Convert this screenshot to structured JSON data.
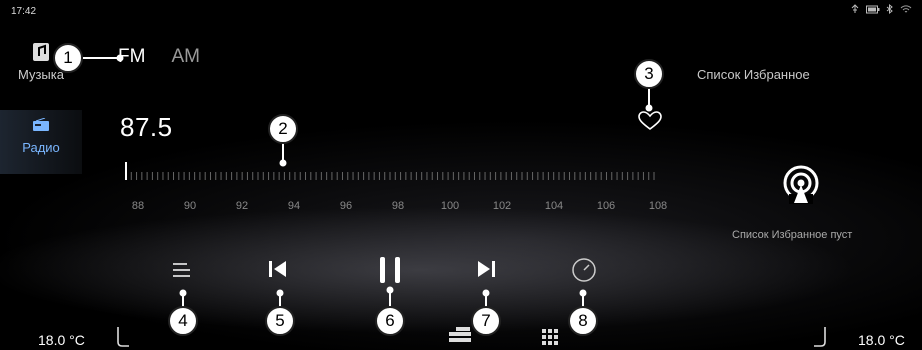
{
  "status": {
    "time": "17:42",
    "icons": [
      "usb-icon",
      "battery-icon",
      "bluetooth-icon",
      "wifi-icon"
    ]
  },
  "sidebar": {
    "items": [
      {
        "label": "Музыка",
        "icon": "music-icon",
        "active": false
      },
      {
        "label": "Радио",
        "icon": "radio-icon",
        "active": true
      }
    ]
  },
  "bands": [
    {
      "label": "FM",
      "selected": true
    },
    {
      "label": "AM",
      "selected": false
    }
  ],
  "frequency": "87.5",
  "scale": {
    "labels": [
      "88",
      "90",
      "92",
      "94",
      "96",
      "98",
      "100",
      "102",
      "104",
      "106",
      "108"
    ]
  },
  "favorites": {
    "title": "Список Избранное",
    "empty": "Список Избранное пуст"
  },
  "controls": [
    "list-icon",
    "previous-icon",
    "pause-icon",
    "next-icon",
    "clock-icon"
  ],
  "climate": {
    "left_temp": "18.0 °C",
    "right_temp": "18.0 °C"
  },
  "callouts": [
    "1",
    "2",
    "3",
    "4",
    "5",
    "6",
    "7",
    "8"
  ]
}
